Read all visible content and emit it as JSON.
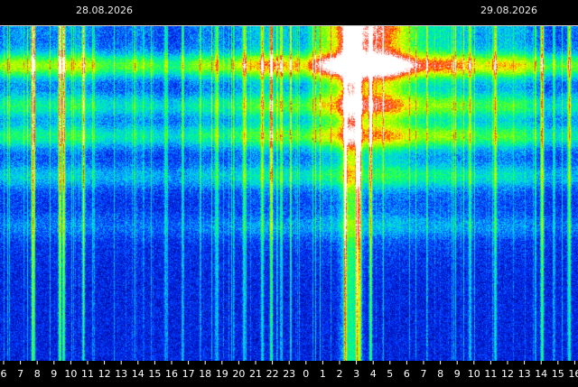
{
  "header": {
    "date_left": "28.08.2026",
    "date_right": "29.08.2026"
  },
  "chart_data": {
    "type": "heatmap",
    "title": "",
    "xlabel": "",
    "ylabel": "",
    "x_tick_labels": [
      "6",
      "7",
      "8",
      "9",
      "10",
      "11",
      "12",
      "13",
      "14",
      "15",
      "16",
      "17",
      "18",
      "19",
      "20",
      "21",
      "22",
      "23",
      "0",
      "1",
      "2",
      "3",
      "4",
      "5",
      "6",
      "7",
      "8",
      "9",
      "10",
      "11",
      "12",
      "13",
      "14",
      "15",
      "16"
    ],
    "x_hours_span": [
      5.8,
      16.0
    ],
    "date_markers": [
      {
        "label": "28.08.2026",
        "at_hour_index": 3.7
      },
      {
        "label": "29.08.2026",
        "at_hour_index": 27.9
      }
    ],
    "color_scale": [
      "#000080",
      "#0030ff",
      "#00c8ff",
      "#00ff80",
      "#80ff00",
      "#ffff00",
      "#ff2000",
      "#ffffff"
    ],
    "intensity_bands": [
      {
        "level_fraction": 0.12,
        "strength": 0.85
      },
      {
        "level_fraction": 0.24,
        "strength": 0.55
      },
      {
        "level_fraction": 0.33,
        "strength": 0.7
      },
      {
        "level_fraction": 0.45,
        "strength": 0.5
      },
      {
        "level_fraction": 0.6,
        "strength": 0.35
      }
    ],
    "peak_activity_hours": [
      "2",
      "3",
      "4",
      "5"
    ],
    "grid": false,
    "legend": "none"
  }
}
